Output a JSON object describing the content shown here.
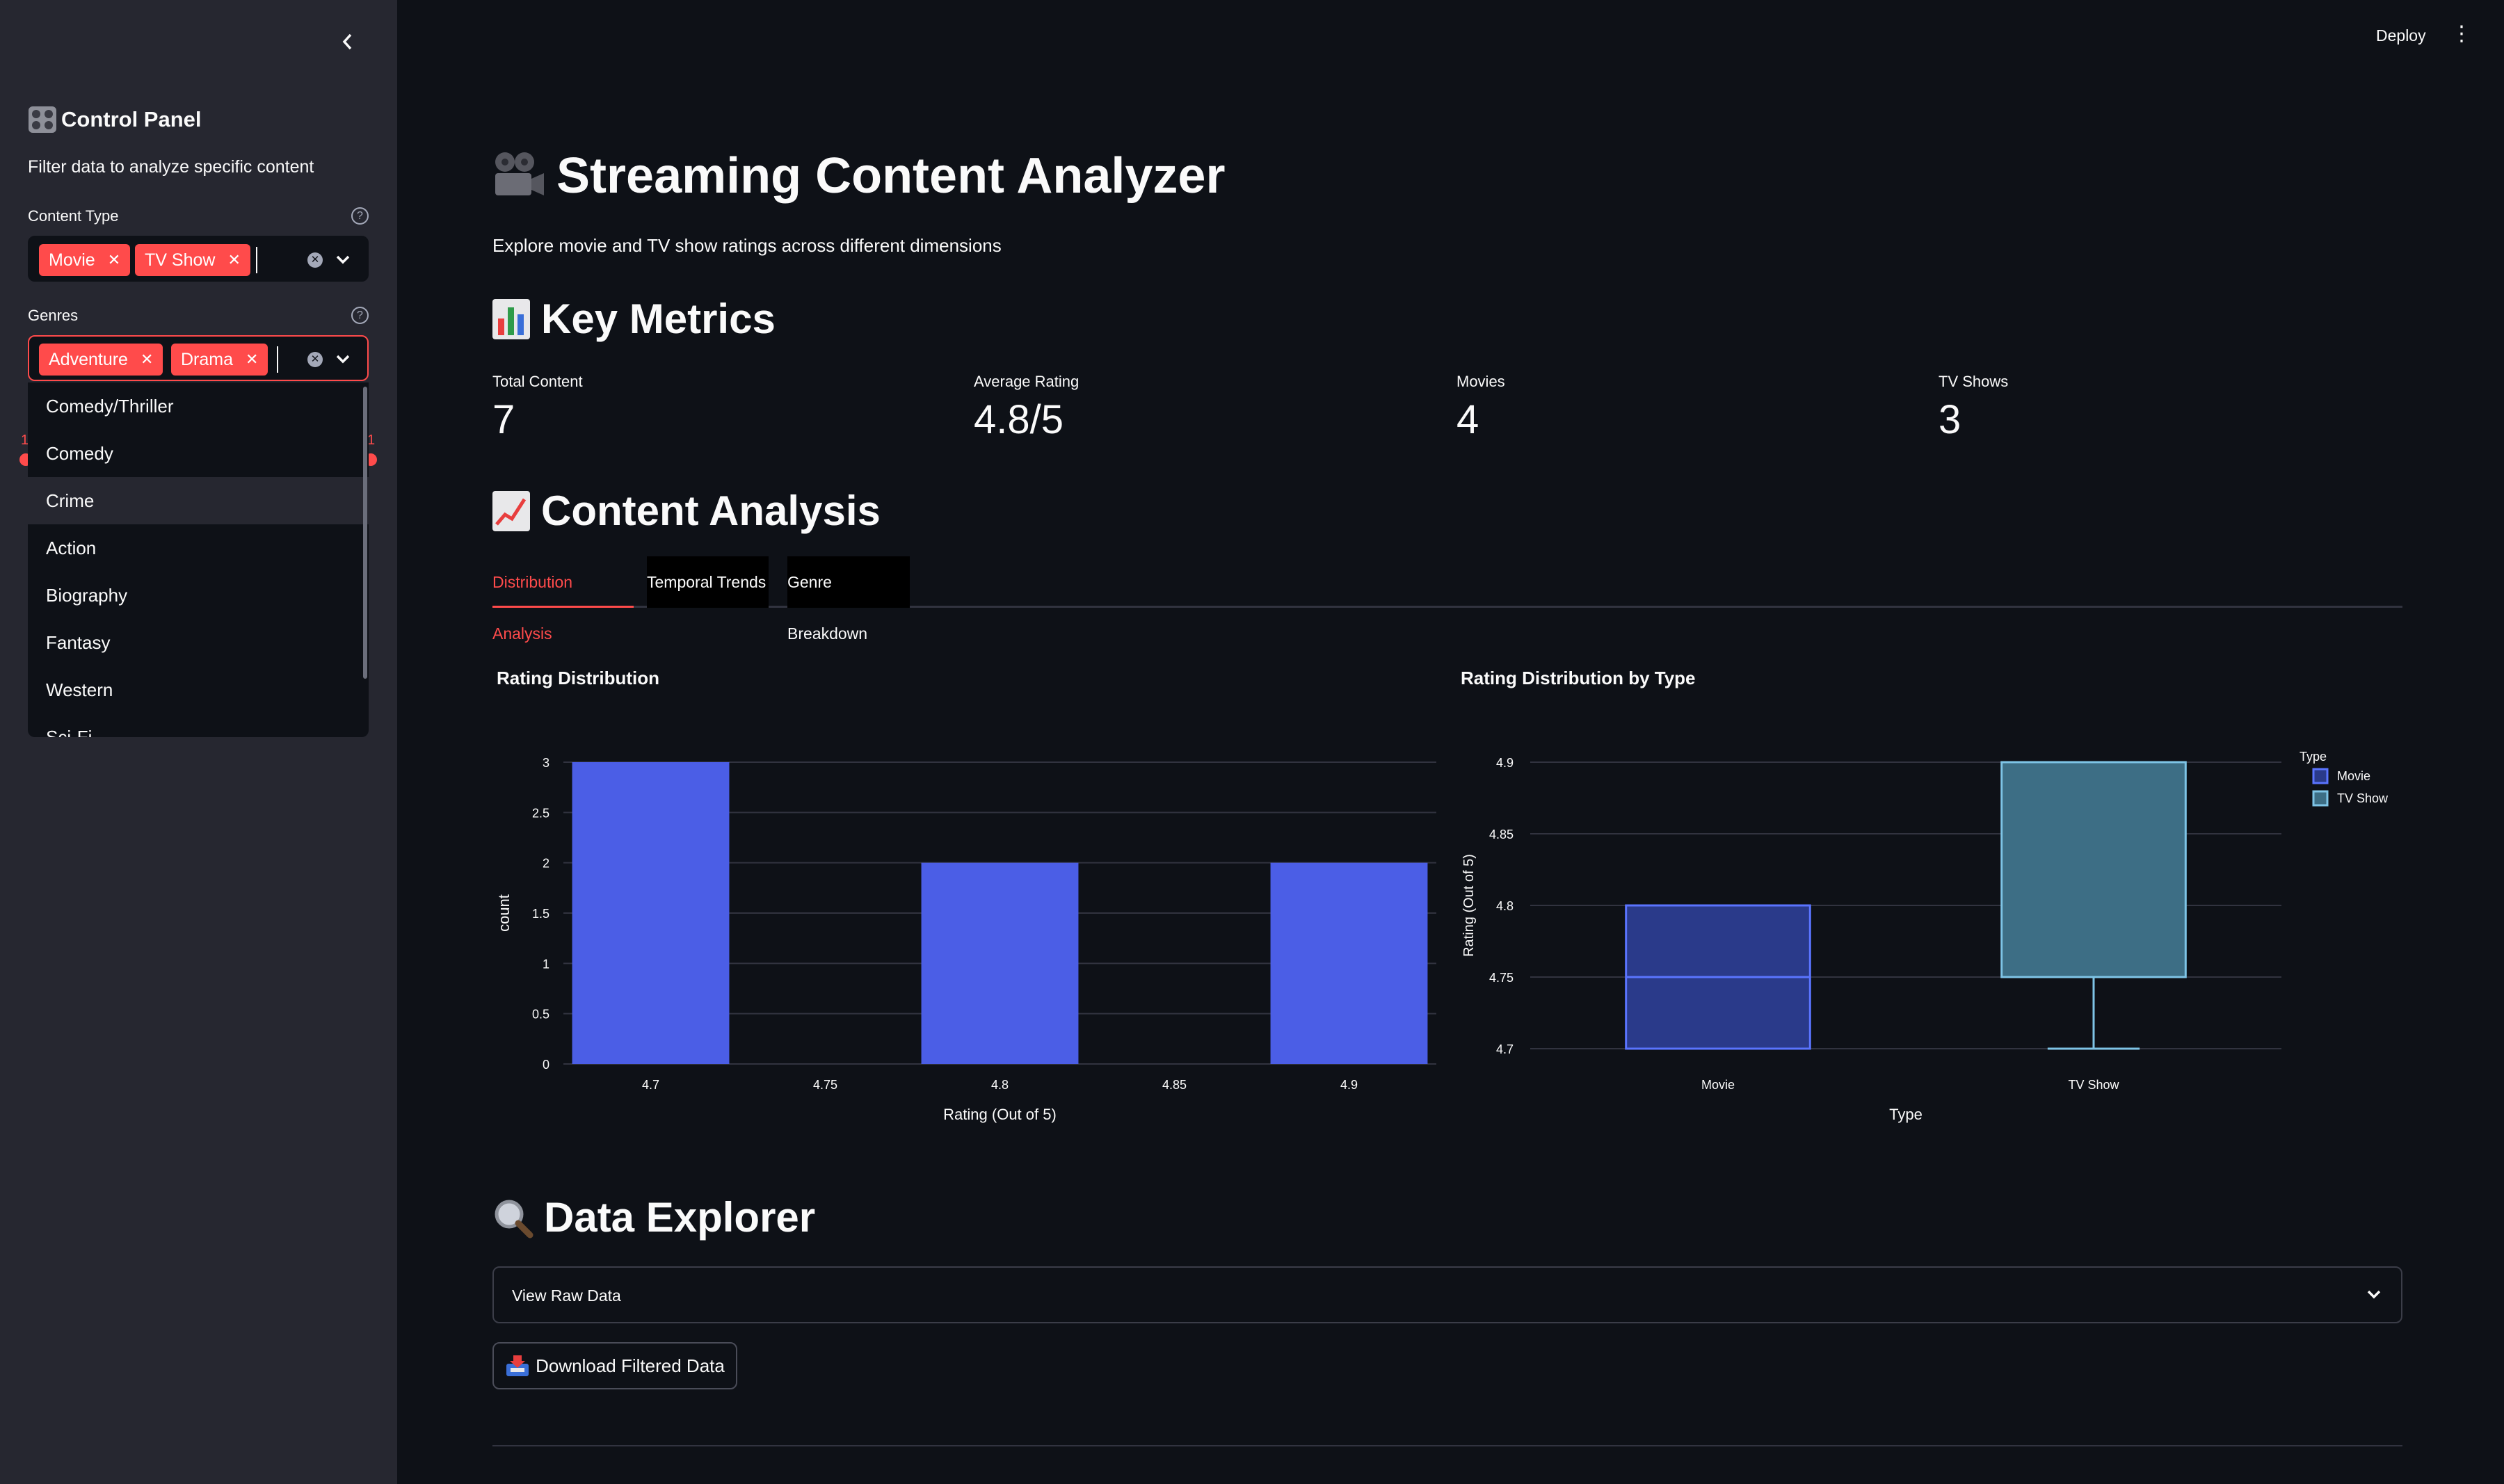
{
  "sidebar": {
    "title_icon": "control-knobs-icon",
    "title": "Control Panel",
    "subtitle": "Filter data to analyze specific content",
    "content_type": {
      "label": "Content Type",
      "selected": [
        "Movie",
        "TV Show"
      ]
    },
    "genres": {
      "label": "Genres",
      "selected": [
        "Adventure",
        "Drama"
      ],
      "options": [
        "Comedy/Thriller",
        "Comedy",
        "Crime",
        "Action",
        "Biography",
        "Fantasy",
        "Western",
        "Sci-Fi"
      ],
      "hovered_option": "Crime"
    },
    "slider_peek": {
      "left": "1",
      "right": "1"
    }
  },
  "header": {
    "deploy_label": "Deploy"
  },
  "main": {
    "title": "Streaming Content Analyzer",
    "title_icon": "movie-camera-icon",
    "subtitle": "Explore movie and TV show ratings across different dimensions",
    "key_metrics": {
      "heading": "Key Metrics",
      "icon": "bar-chart-icon",
      "items": [
        {
          "label": "Total Content",
          "value": "7"
        },
        {
          "label": "Average Rating",
          "value": "4.8/5"
        },
        {
          "label": "Movies",
          "value": "4"
        },
        {
          "label": "TV Shows",
          "value": "3"
        }
      ]
    },
    "content_analysis": {
      "heading": "Content Analysis",
      "icon": "chart-increasing-icon",
      "tabs": [
        "Distribution Analysis",
        "Temporal Trends",
        "Genre Breakdown"
      ],
      "active_tab": "Distribution Analysis"
    },
    "data_explorer": {
      "heading": "Data Explorer",
      "icon": "magnifier-icon",
      "expander_label": "View Raw Data",
      "download_label": "Download Filtered Data",
      "download_icon": "inbox-tray-icon"
    }
  },
  "colors": {
    "accent": "#ff4b4b",
    "bar": "#4b5ee6",
    "movie_box": "#2a3a8a",
    "tv_box": "#3d6e85",
    "tv_line": "#7ec4e6"
  },
  "chart_data": [
    {
      "type": "bar",
      "title": "Rating Distribution",
      "xlabel": "Rating (Out of 5)",
      "ylabel": "count",
      "x_ticks": [
        "4.7",
        "4.75",
        "4.8",
        "4.85",
        "4.9"
      ],
      "y_ticks": [
        "0",
        "0.5",
        "1",
        "1.5",
        "2",
        "2.5",
        "3"
      ],
      "ylim": [
        0,
        3
      ],
      "xlim": [
        4.675,
        4.925
      ],
      "bars": [
        {
          "x": 4.7,
          "value": 3
        },
        {
          "x": 4.8,
          "value": 2
        },
        {
          "x": 4.9,
          "value": 2
        }
      ],
      "grid": true
    },
    {
      "type": "box",
      "title": "Rating Distribution by Type",
      "xlabel": "Type",
      "ylabel": "Rating (Out of 5)",
      "categories": [
        "Movie",
        "TV Show"
      ],
      "y_ticks": [
        "4.7",
        "4.75",
        "4.8",
        "4.85",
        "4.9"
      ],
      "ylim": [
        4.7,
        4.9
      ],
      "legend_title": "Type",
      "legend_position": "top-right",
      "series": [
        {
          "name": "Movie",
          "min": 4.7,
          "q1": 4.7,
          "median": 4.75,
          "q3": 4.8,
          "max": 4.8
        },
        {
          "name": "TV Show",
          "min": 4.7,
          "q1": 4.75,
          "median": 4.75,
          "q3": 4.9,
          "max": 4.9
        }
      ],
      "grid": true
    }
  ]
}
